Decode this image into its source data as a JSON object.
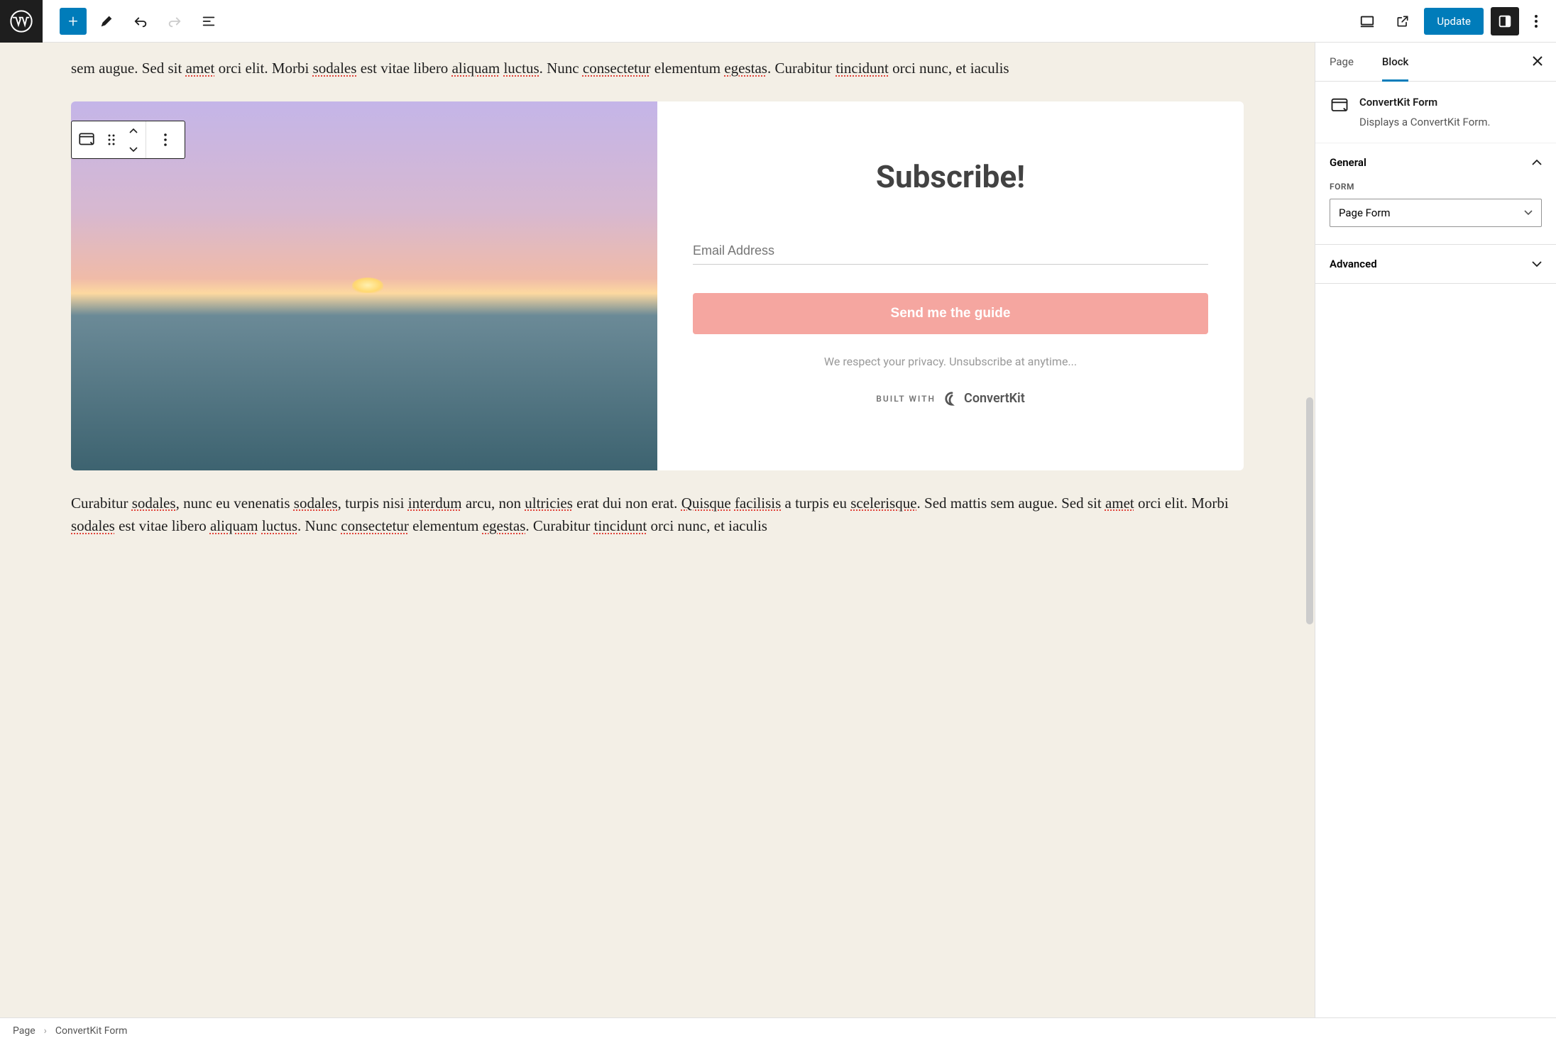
{
  "topbar": {
    "update_label": "Update"
  },
  "editor": {
    "para1": "sem augue. Sed sit amet orci elit. Morbi sodales est vitae libero aliquam luctus. Nunc consectetur elementum egestas. Curabitur tincidunt orci nunc, et iaculis",
    "para2": "Curabitur sodales, nunc eu venenatis sodales, turpis nisi interdum arcu, non ultricies erat dui non erat. Quisque facilisis a turpis eu scelerisque. Sed mattis sem augue. Sed sit amet orci elit. Morbi sodales est vitae libero aliquam luctus. Nunc consectetur elementum egestas. Curabitur tincidunt orci nunc, et iaculis",
    "spellcheck_words": [
      "amet",
      "sodales",
      "aliquam",
      "luctus",
      "consectetur",
      "egestas",
      "tincidunt",
      "ultricies",
      "Quisque",
      "facilisis",
      "scelerisque",
      "interdum"
    ]
  },
  "subscribe": {
    "title": "Subscribe!",
    "email_placeholder": "Email Address",
    "button_label": "Send me the guide",
    "privacy": "We respect your privacy. Unsubscribe at anytime...",
    "built_with": "BUILT WITH",
    "brand": "ConvertKit"
  },
  "sidebar": {
    "tabs": {
      "page": "Page",
      "block": "Block"
    },
    "block_name": "ConvertKit Form",
    "block_desc": "Displays a ConvertKit Form.",
    "panels": {
      "general": {
        "title": "General",
        "form_label": "Form",
        "form_value": "Page Form"
      },
      "advanced": {
        "title": "Advanced"
      }
    }
  },
  "footer": {
    "crumb1": "Page",
    "crumb2": "ConvertKit Form"
  }
}
